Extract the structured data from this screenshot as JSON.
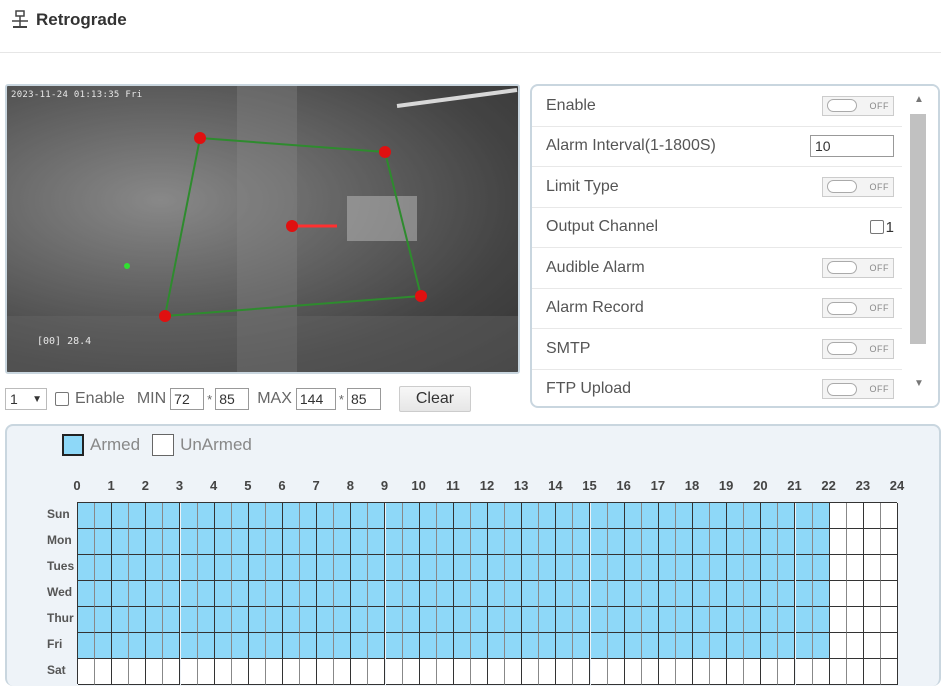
{
  "header": {
    "title": "Retrograde",
    "icon": "network-icon"
  },
  "video": {
    "timestamp": "2023-11-24 01:13:35 Fri",
    "temperature": "[00] 28.4"
  },
  "controls": {
    "select_value": "1",
    "enable_label": "Enable",
    "min_label": "MIN",
    "min_w": "72",
    "min_h": "85",
    "times": "*",
    "max_label": "MAX",
    "max_w": "144",
    "max_h": "85",
    "clear_label": "Clear"
  },
  "settings": {
    "enable": {
      "label": "Enable",
      "state": "OFF"
    },
    "alarm_interval": {
      "label": "Alarm Interval(1-1800S)",
      "value": "10"
    },
    "limit_type": {
      "label": "Limit Type",
      "state": "OFF"
    },
    "output_channel": {
      "label": "Output Channel",
      "channel": "1"
    },
    "audible_alarm": {
      "label": "Audible Alarm",
      "state": "OFF"
    },
    "alarm_record": {
      "label": "Alarm Record",
      "state": "OFF"
    },
    "smtp": {
      "label": "SMTP",
      "state": "OFF"
    },
    "ftp_upload": {
      "label": "FTP Upload",
      "state": "OFF"
    }
  },
  "schedule": {
    "armed_label": "Armed",
    "unarmed_label": "UnArmed",
    "armed_color": "#8ed8f8",
    "hours": [
      "0",
      "1",
      "2",
      "3",
      "4",
      "5",
      "6",
      "7",
      "8",
      "9",
      "10",
      "11",
      "12",
      "13",
      "14",
      "15",
      "16",
      "17",
      "18",
      "19",
      "20",
      "21",
      "22",
      "23",
      "24"
    ],
    "days": [
      "Sun",
      "Mon",
      "Tues",
      "Wed",
      "Thur",
      "Fri",
      "Sat"
    ],
    "armed_until_hour": [
      22,
      22,
      22,
      22,
      22,
      22,
      0
    ]
  }
}
